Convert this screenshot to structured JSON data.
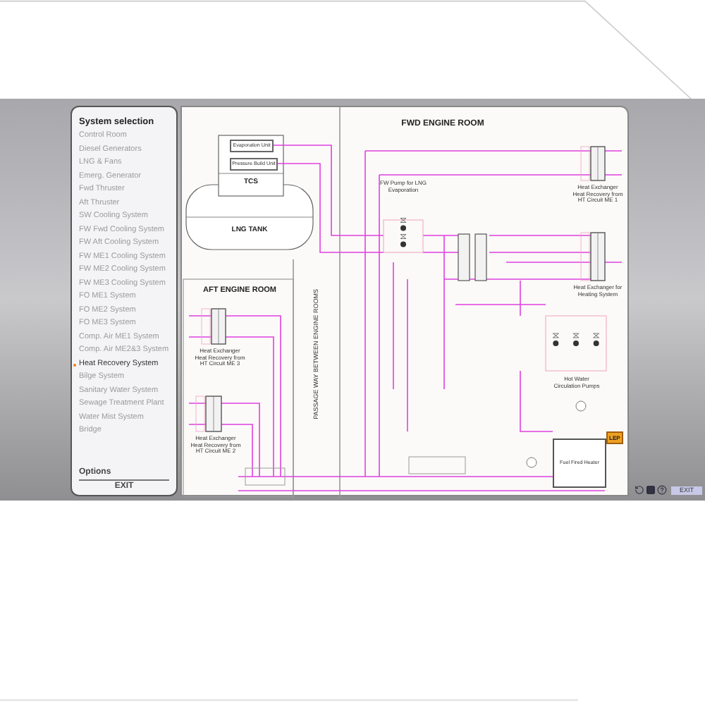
{
  "sidebar": {
    "title": "System selection",
    "items": [
      {
        "label": "Control Room",
        "selected": false
      },
      {
        "label": "Diesel Generators",
        "selected": false
      },
      {
        "label": "LNG & Fans",
        "selected": false
      },
      {
        "label": "Emerg. Generator",
        "selected": false
      },
      {
        "label": "Fwd Thruster",
        "selected": false
      },
      {
        "label": "Aft Thruster",
        "selected": false
      },
      {
        "label": "SW Cooling System",
        "selected": false
      },
      {
        "label": "FW Fwd Cooling System",
        "selected": false
      },
      {
        "label": "FW Aft Cooling System",
        "selected": false
      },
      {
        "label": "FW ME1 Cooling System",
        "selected": false
      },
      {
        "label": "FW ME2 Cooling System",
        "selected": false
      },
      {
        "label": "FW ME3 Cooling System",
        "selected": false
      },
      {
        "label": "FO ME1 System",
        "selected": false
      },
      {
        "label": "FO ME2 System",
        "selected": false
      },
      {
        "label": "FO ME3 System",
        "selected": false
      },
      {
        "label": "Comp. Air ME1 System",
        "selected": false
      },
      {
        "label": "Comp. Air ME2&3 System",
        "selected": false
      },
      {
        "label": "Heat Recovery System",
        "selected": true
      },
      {
        "label": "Bilge System",
        "selected": false
      },
      {
        "label": "Sanitary Water System",
        "selected": false
      },
      {
        "label": "Sewage Treatment Plant",
        "selected": false
      },
      {
        "label": "Water Mist System",
        "selected": false
      },
      {
        "label": "Bridge",
        "selected": false
      }
    ],
    "options": "Options",
    "exit": "EXIT"
  },
  "diagram": {
    "fwd_title": "FWD ENGINE ROOM",
    "aft_title": "AFT ENGINE ROOM",
    "passage": "PASSAGE WAY BETWEEN ENGINE ROOMS",
    "tcs": "TCS",
    "tank": "LNG TANK",
    "badge": "LEP",
    "equipment": [
      {
        "kind": "unit",
        "label": "Evaporation Unit"
      },
      {
        "kind": "unit",
        "label": "Pressure Build Unit"
      },
      {
        "kind": "pump_group",
        "label": "FW Pump for LNG Evaporation"
      },
      {
        "kind": "heat_exchanger",
        "label": "Heat Exchanger Heat Recovery from HT Circuit ME 1"
      },
      {
        "kind": "heat_exchanger",
        "label": "Heat Exchanger for Heating System"
      },
      {
        "kind": "pump_group",
        "label": "Hot Water Circulation Pumps"
      },
      {
        "kind": "heat_exchanger",
        "label": "Heat Exchanger Heat Recovery from HT Circuit ME 3"
      },
      {
        "kind": "heat_exchanger",
        "label": "Heat Exchanger Heat Recovery from HT Circuit ME 2"
      },
      {
        "kind": "heater",
        "label": "Fuel Fired Heater"
      }
    ]
  },
  "toolbar": {
    "exit": "EXIT"
  }
}
